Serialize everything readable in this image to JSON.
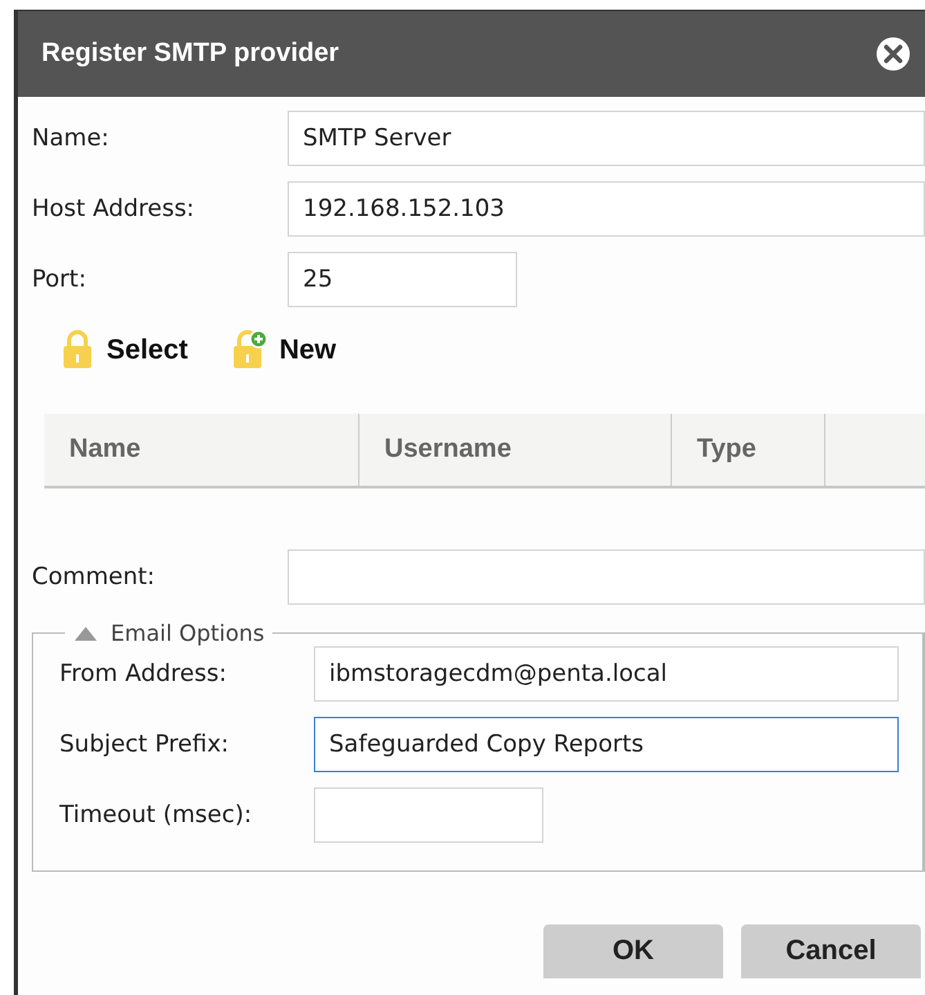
{
  "window": {
    "title": "Register SMTP provider"
  },
  "fields": [
    {
      "label": "Name:",
      "value": "SMTP Server",
      "kind": "long",
      "focused": false
    },
    {
      "label": "Host Address:",
      "value": "192.168.152.103",
      "kind": "long",
      "focused": false
    },
    {
      "label": "Port:",
      "value": "25",
      "kind": "short",
      "focused": false
    }
  ],
  "toolbar": [
    {
      "label": "Select",
      "kind": "lock"
    },
    {
      "label": "New",
      "kind": "lock-add"
    }
  ],
  "table": {
    "columns": [
      "Name",
      "Username",
      "Type"
    ]
  },
  "comment": {
    "label": "Comment:",
    "focused": false
  },
  "email_options": {
    "legend": "Email Options",
    "expanded": true,
    "fields": [
      {
        "label": "From Address:",
        "value": "ibmstoragecdm@penta.local",
        "kind": "long",
        "focused": false
      },
      {
        "label": "Subject Prefix:",
        "value": "Safeguarded Copy Reports",
        "kind": "long",
        "focused": true
      },
      {
        "label": "Timeout (msec):",
        "kind": "short",
        "focused": false
      }
    ]
  },
  "buttons": [
    "OK",
    "Cancel"
  ]
}
